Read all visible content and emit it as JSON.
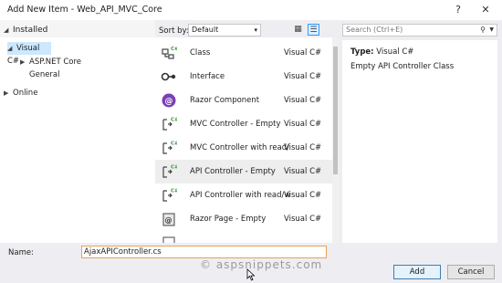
{
  "window": {
    "title": "Add New Item - Web_API_MVC_Core",
    "help_label": "?",
    "close_label": "✕"
  },
  "left_pane": {
    "header": "Installed",
    "tree": [
      {
        "label": "Visual C#",
        "caret": "◢",
        "selected": true
      },
      {
        "label": "ASP.NET Core",
        "caret": "▶",
        "selected": false
      },
      {
        "label": "General",
        "caret": "",
        "selected": false
      },
      {
        "label": "Online",
        "caret": "▶",
        "selected": false
      }
    ]
  },
  "sort": {
    "label": "Sort by:",
    "value": "Default",
    "arrow": "▾"
  },
  "search": {
    "placeholder": "Search (Ctrl+E)",
    "icon": "search-icon"
  },
  "templates": [
    {
      "name": "Class",
      "lang": "Visual C#",
      "icon": "class-icon"
    },
    {
      "name": "Interface",
      "lang": "Visual C#",
      "icon": "interface-icon"
    },
    {
      "name": "Razor Component",
      "lang": "Visual C#",
      "icon": "razor-component-icon"
    },
    {
      "name": "MVC Controller - Empty",
      "lang": "Visual C#",
      "icon": "controller-icon"
    },
    {
      "name": "MVC Controller with read/write...",
      "lang": "Visual C#",
      "icon": "controller-icon"
    },
    {
      "name": "API Controller - Empty",
      "lang": "Visual C#",
      "icon": "controller-icon",
      "selected": true
    },
    {
      "name": "API Controller with read/write...",
      "lang": "Visual C#",
      "icon": "controller-icon"
    },
    {
      "name": "Razor Page - Empty",
      "lang": "Visual C#",
      "icon": "razor-page-icon"
    }
  ],
  "details": {
    "type_label": "Type:",
    "type_value": "Visual C#",
    "description": "Empty API Controller Class"
  },
  "name_field": {
    "label": "Name:",
    "value": "AjaxAPIController.cs"
  },
  "watermark": "© aspsnippets.com",
  "buttons": {
    "add": "Add",
    "cancel": "Cancel"
  },
  "colors": {
    "accent": "#3c7fb1",
    "selection": "#cce8ff",
    "csharp_green": "#3a9a3a"
  }
}
